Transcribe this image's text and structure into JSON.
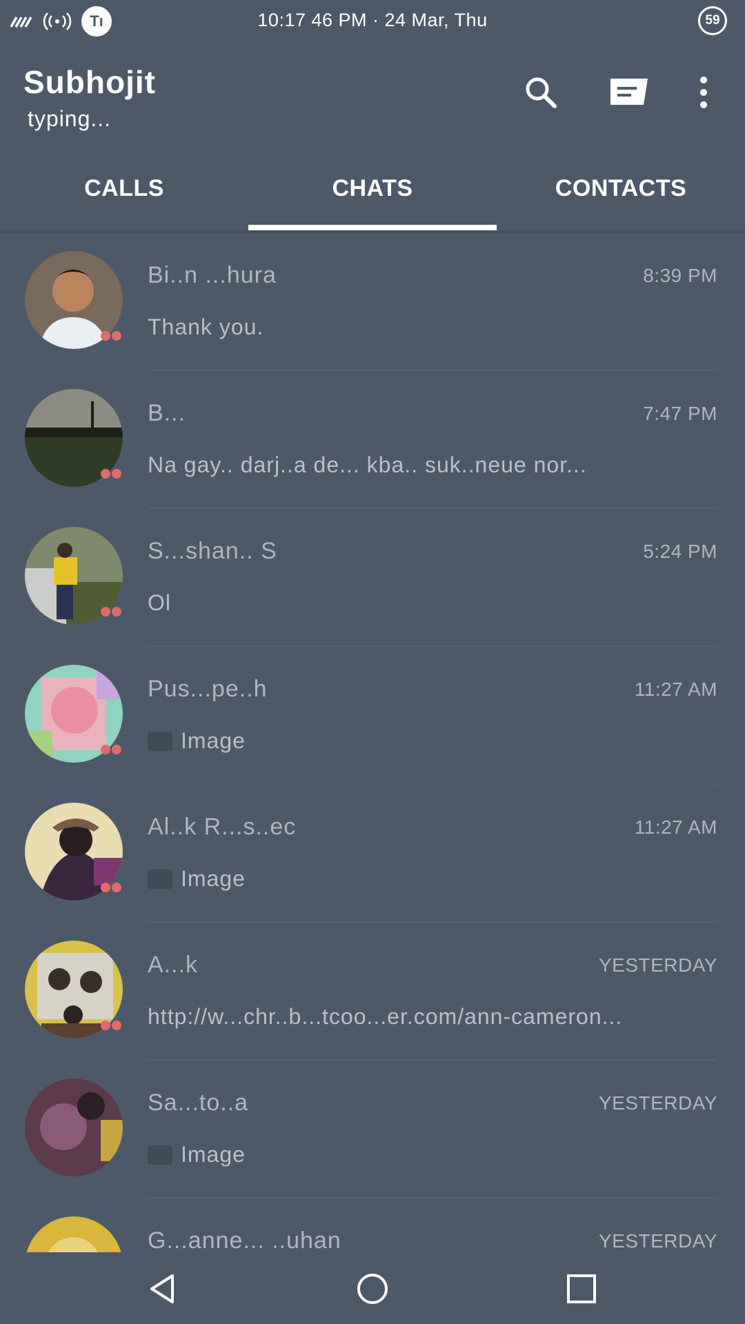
{
  "status_bar": {
    "time": "10:17 46 PM · 24 Mar, Thu",
    "battery": "59",
    "badge": "Tı"
  },
  "header": {
    "title": "Subhojit",
    "subtitle": "typing..."
  },
  "tabs": [
    {
      "label": "CALLS",
      "active": false
    },
    {
      "label": "CHATS",
      "active": true
    },
    {
      "label": "CONTACTS",
      "active": false
    }
  ],
  "chats": [
    {
      "name": "Bi..n ...hura",
      "time": "8:39 PM",
      "preview": "Thank you.",
      "image_preview": false,
      "avatar_color": "#5a4a3e"
    },
    {
      "name": "B...",
      "time": "7:47 PM",
      "preview": "Na gay.. darj..a de... kba.. suk..neue nor...",
      "image_preview": false,
      "avatar_color": "#3b4a32"
    },
    {
      "name": "S...shan.. S",
      "time": "5:24 PM",
      "preview": "Ol",
      "image_preview": false,
      "avatar_color": "#6f7a52"
    },
    {
      "name": "Pus...pe..h",
      "time": "11:27 AM",
      "preview": "Image",
      "image_preview": true,
      "avatar_color": "#d89aa5"
    },
    {
      "name": "Al..k R...s..ec",
      "time": "11:27 AM",
      "preview": "Image",
      "image_preview": true,
      "avatar_color": "#3a3044"
    },
    {
      "name": "A...k",
      "time": "YESTERDAY",
      "preview": "http://w...chr..b...tcoo...er.com/ann-cameron...",
      "image_preview": false,
      "avatar_color": "#c9b44a"
    },
    {
      "name": "Sa...to..a",
      "time": "YESTERDAY",
      "preview": "Image",
      "image_preview": true,
      "avatar_color": "#6b3a55"
    },
    {
      "name": "G...anne... ..uhan",
      "time": "YESTERDAY",
      "preview": "",
      "image_preview": false,
      "avatar_color": "#d9b63c"
    }
  ],
  "colors": {
    "background": "#4d5968",
    "text_primary": "#ffffff",
    "text_secondary": "#aeb6c1",
    "status_dot": "#e36a6a"
  }
}
